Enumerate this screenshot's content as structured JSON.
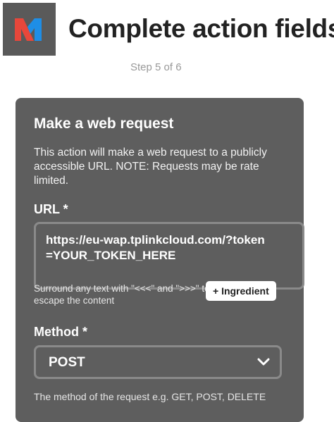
{
  "header": {
    "title": "Complete action fields",
    "step": "Step 5 of 6",
    "logo_icon": "maker-webhooks-logo",
    "logo_colors": {
      "background": "#5a5a5a",
      "red": "#e8473b",
      "blue": "#1e8ee6"
    }
  },
  "card": {
    "title": "Make a web request",
    "description": "This action will make a web request to a publicly accessible URL. NOTE: Requests may be rate limited.",
    "url_label": "URL *",
    "url_value": "https://eu-wap.tplinkcloud.com/?token=YOUR_TOKEN_HERE",
    "url_hint": "Surround any text with \"<<<\" and \">>>\" to escape the content",
    "ingredient_button": "+ Ingredient",
    "method_label": "Method *",
    "method_value": "POST",
    "method_hint": "The method of the request e.g. GET, POST, DELETE",
    "dropdown_icon": "chevron-down-icon",
    "background_color": "#5e5e5e"
  }
}
